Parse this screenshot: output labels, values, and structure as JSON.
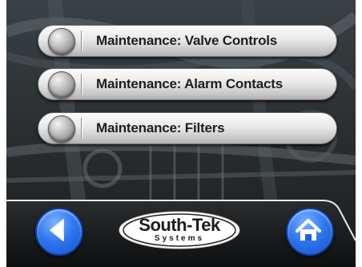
{
  "menu": {
    "items": [
      {
        "label": "Maintenance: Valve Controls"
      },
      {
        "label": "Maintenance: Alarm Contacts"
      },
      {
        "label": "Maintenance: Filters"
      }
    ]
  },
  "footer": {
    "back_icon": "back-arrow-icon",
    "home_icon": "home-icon",
    "logo_text": "South-Tek",
    "logo_subtext": "Systems"
  },
  "colors": {
    "accent_blue": "#2f78ee",
    "button_silver": "#d9d9d9",
    "footer_dark": "#151618"
  }
}
